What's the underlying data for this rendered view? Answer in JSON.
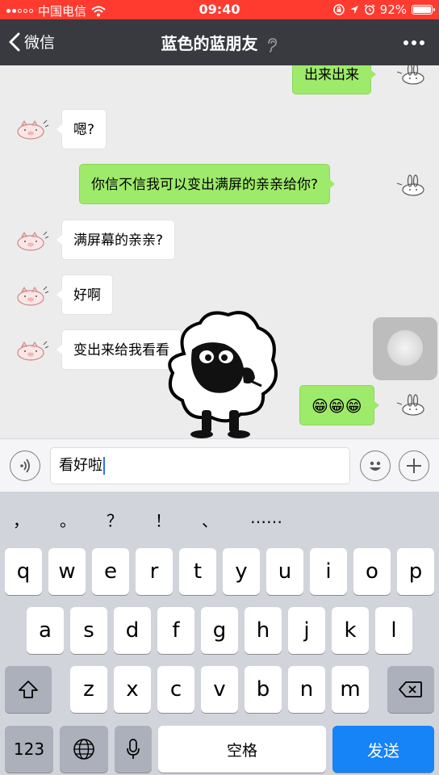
{
  "status_bar": {
    "carrier": "中国电信",
    "time": "09:40",
    "battery": "92%"
  },
  "nav": {
    "back_label": "微信",
    "title": "蓝色的蓝朋友"
  },
  "messages": [
    {
      "side": "out",
      "text": "出来出来"
    },
    {
      "side": "in",
      "text": "嗯?"
    },
    {
      "side": "out",
      "text": "你信不信我可以变出满屏的亲亲给你?"
    },
    {
      "side": "in",
      "text": "满屏幕的亲亲?"
    },
    {
      "side": "in",
      "text": "好啊"
    },
    {
      "side": "in",
      "text": "变出来给我看看"
    },
    {
      "side": "out",
      "text": "😁😁😁"
    }
  ],
  "input": {
    "value": "看好啦"
  },
  "suggestions": [
    "，",
    "。",
    "？",
    "！",
    "、",
    "……"
  ],
  "keyboard": {
    "row1": [
      "q",
      "w",
      "e",
      "r",
      "t",
      "y",
      "u",
      "i",
      "o",
      "p"
    ],
    "row2": [
      "a",
      "s",
      "d",
      "f",
      "g",
      "h",
      "j",
      "k",
      "l"
    ],
    "row3": [
      "z",
      "x",
      "c",
      "v",
      "b",
      "n",
      "m"
    ],
    "numbers_label": "123",
    "space_label": "空格",
    "send_label": "发送"
  },
  "colors": {
    "status_bar": "#ff3b30",
    "nav_bar": "#393a3f",
    "outgoing_bubble": "#9eea6a",
    "send_key": "#1683f6"
  }
}
